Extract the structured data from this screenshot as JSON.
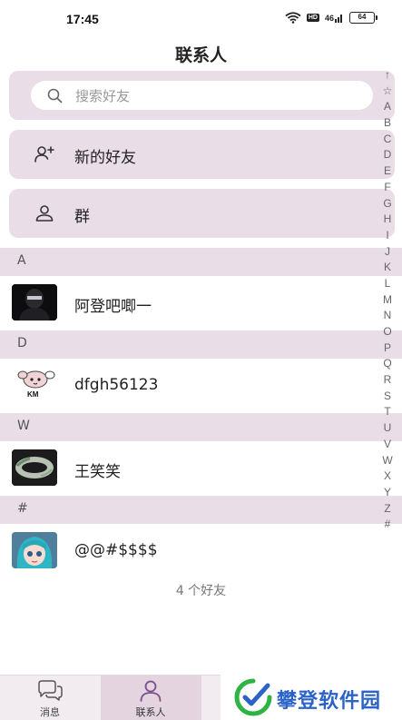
{
  "status_bar": {
    "time": "17:45",
    "hd": "HD",
    "signal": "46",
    "battery": "64"
  },
  "header": {
    "title": "联系人"
  },
  "search": {
    "placeholder": "搜索好友"
  },
  "nav": {
    "new_friends": "新的好友",
    "groups": "群"
  },
  "sections": [
    {
      "letter": "A",
      "contact": {
        "name": "阿登吧唧一"
      }
    },
    {
      "letter": "D",
      "contact": {
        "name": "dfgh56123",
        "avatar_text": "KM"
      }
    },
    {
      "letter": "W",
      "contact": {
        "name": "王笑笑"
      }
    },
    {
      "letter": "#",
      "contact": {
        "name": "@@#$$$$"
      }
    }
  ],
  "friends_count": "4 个好友",
  "index_letters": [
    "↑",
    "☆",
    "A",
    "B",
    "C",
    "D",
    "E",
    "F",
    "G",
    "H",
    "I",
    "J",
    "K",
    "L",
    "M",
    "N",
    "O",
    "P",
    "Q",
    "R",
    "S",
    "T",
    "U",
    "V",
    "W",
    "X",
    "Y",
    "Z",
    "#"
  ],
  "tabs": {
    "messages": "消息",
    "contacts": "联系人"
  },
  "watermark": {
    "text": "攀登软件园"
  },
  "colors": {
    "card_bg": "#e9dde7",
    "tab_active_bg": "#e3d4e0",
    "accent": "#7b4f8a",
    "watermark_blue": "#2b63c9",
    "watermark_green": "#2fb344"
  }
}
